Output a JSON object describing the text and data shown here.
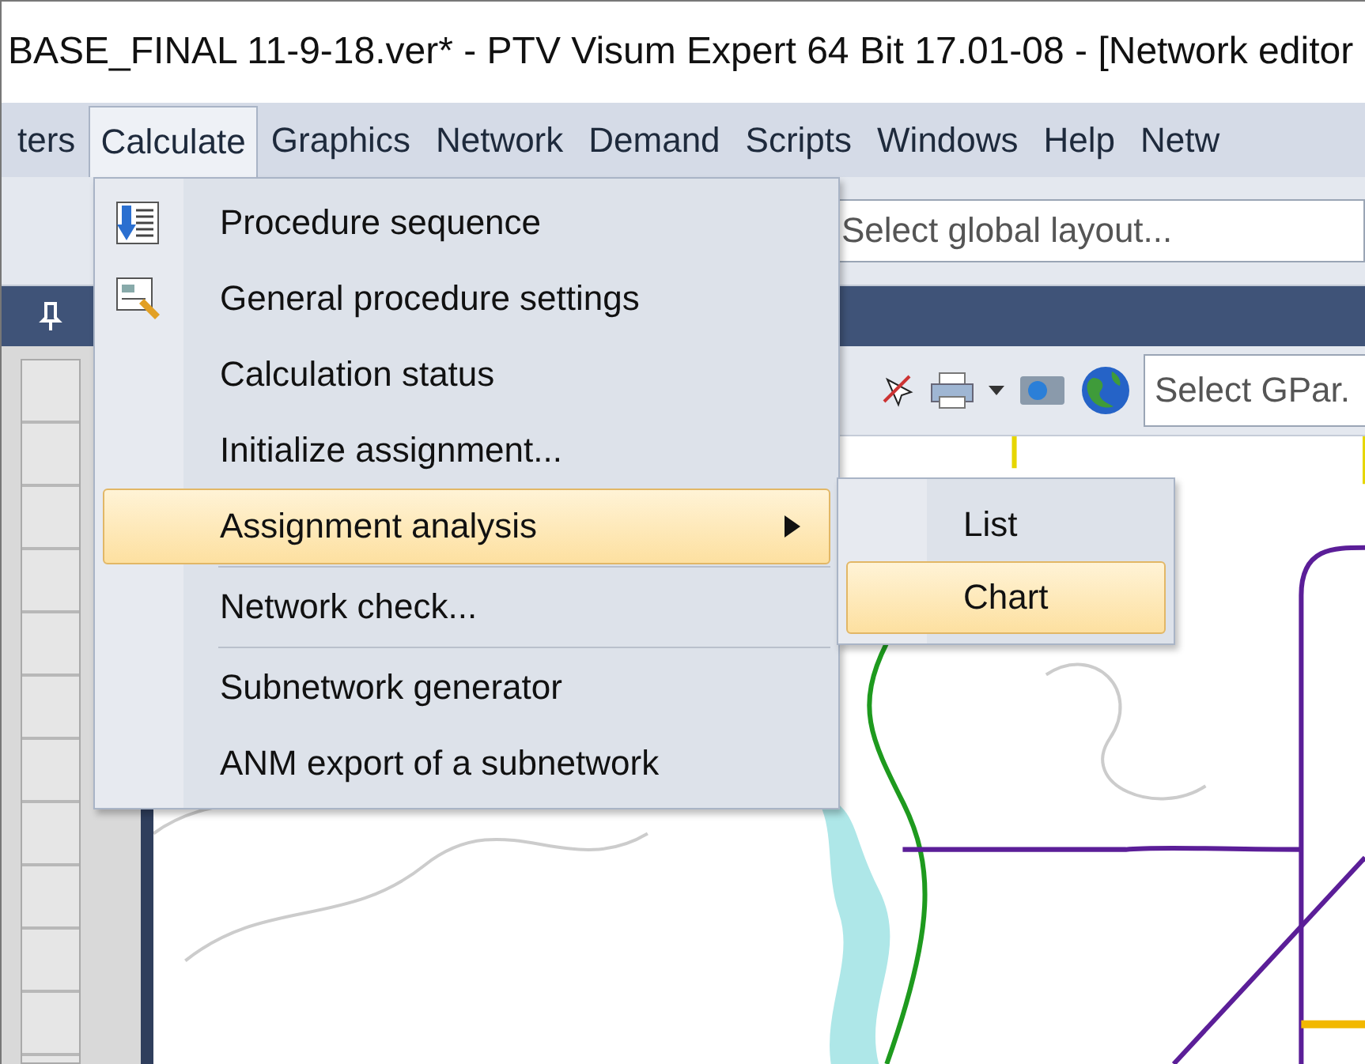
{
  "window": {
    "title": "BASE_FINAL 11-9-18.ver* - PTV Visum Expert 64 Bit 17.01-08 - [Network editor"
  },
  "menu_bar": [
    {
      "label": "ters",
      "selected": false
    },
    {
      "label": "Calculate",
      "selected": true
    },
    {
      "label": "Graphics",
      "selected": false
    },
    {
      "label": "Network",
      "selected": false
    },
    {
      "label": "Demand",
      "selected": false
    },
    {
      "label": "Scripts",
      "selected": false
    },
    {
      "label": "Windows",
      "selected": false
    },
    {
      "label": "Help",
      "selected": false
    },
    {
      "label": "Netw",
      "selected": false
    }
  ],
  "toolbar": {
    "layout_field": {
      "placeholder": "Select global layout..."
    }
  },
  "editor_toolbar": {
    "gpar_field": {
      "placeholder": "Select GPar."
    }
  },
  "menu": [
    {
      "kind": "item",
      "label": "Procedure sequence",
      "selected": false,
      "submenu": false
    },
    {
      "kind": "item",
      "label": "General procedure settings",
      "selected": false,
      "submenu": false
    },
    {
      "kind": "item",
      "label": "Calculation status",
      "selected": false,
      "submenu": false
    },
    {
      "kind": "item",
      "label": "Initialize assignment...",
      "selected": false,
      "submenu": false
    },
    {
      "kind": "item",
      "label": "Assignment analysis",
      "selected": true,
      "submenu": true
    },
    {
      "kind": "separator"
    },
    {
      "kind": "item",
      "label": "Network check...",
      "selected": false,
      "submenu": false
    },
    {
      "kind": "separator"
    },
    {
      "kind": "item",
      "label": "Subnetwork generator",
      "selected": false,
      "submenu": false
    },
    {
      "kind": "item",
      "label": "ANM export of a subnetwork",
      "selected": false,
      "submenu": false
    }
  ],
  "submenu": [
    {
      "label": "List",
      "selected": false
    },
    {
      "label": "Chart",
      "selected": true
    }
  ]
}
